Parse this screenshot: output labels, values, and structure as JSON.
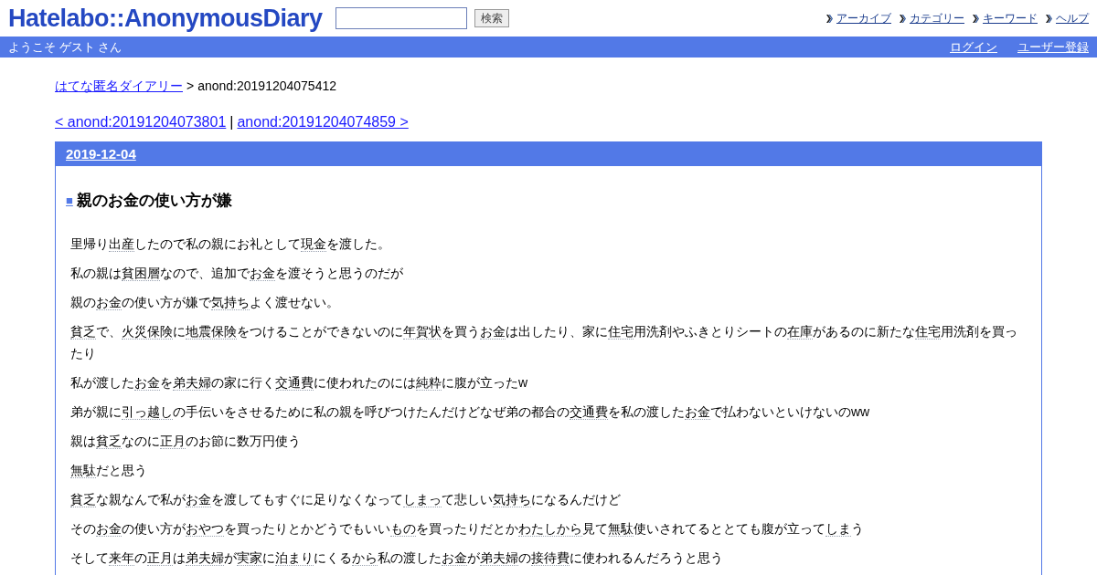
{
  "header": {
    "logo": "Hatelabo::AnonymousDiary",
    "search": {
      "button": "検索"
    },
    "links": [
      "アーカイブ",
      "カテゴリー",
      "キーワード",
      "ヘルプ"
    ]
  },
  "user_bar": {
    "welcome": "ようこそ ゲスト さん",
    "links": [
      "ログイン",
      "ユーザー登録"
    ]
  },
  "breadcrumb": {
    "home": "はてな匿名ダイアリー",
    "separator": ">",
    "current": "anond:20191204075412"
  },
  "pager": {
    "prev": "< anond:20191204073801",
    "separator": "|",
    "next": "anond:20191204074859 >"
  },
  "day": {
    "date": "2019-12-04",
    "title_mark": "■",
    "title": "親のお金の使い方が嫌",
    "paragraphs": [
      [
        {
          "text": "里帰り",
          "keyword": false
        },
        {
          "text": "出産",
          "keyword": true
        },
        {
          "text": "したので私の親にお礼として",
          "keyword": false
        },
        {
          "text": "現金",
          "keyword": true
        },
        {
          "text": "を渡した。",
          "keyword": false
        }
      ],
      [
        {
          "text": "私の親は",
          "keyword": false
        },
        {
          "text": "貧困層",
          "keyword": true
        },
        {
          "text": "なので、追加で",
          "keyword": false
        },
        {
          "text": "お金",
          "keyword": true
        },
        {
          "text": "を渡そうと思うのだが",
          "keyword": false
        }
      ],
      [
        {
          "text": "親の",
          "keyword": false
        },
        {
          "text": "お金",
          "keyword": true
        },
        {
          "text": "の使い方が嫌で",
          "keyword": false
        },
        {
          "text": "気持ち",
          "keyword": true
        },
        {
          "text": "よく渡せない。",
          "keyword": false
        }
      ],
      [
        {
          "text": "貧乏",
          "keyword": true
        },
        {
          "text": "で、",
          "keyword": false
        },
        {
          "text": "火災保険",
          "keyword": true
        },
        {
          "text": "に",
          "keyword": false
        },
        {
          "text": "地震保険",
          "keyword": true
        },
        {
          "text": "をつけることができないのに",
          "keyword": false
        },
        {
          "text": "年賀状",
          "keyword": true
        },
        {
          "text": "を買う",
          "keyword": false
        },
        {
          "text": "お金",
          "keyword": true
        },
        {
          "text": "は出したり、家に",
          "keyword": false
        },
        {
          "text": "住宅",
          "keyword": true
        },
        {
          "text": "用洗剤やふきとりシートの",
          "keyword": false
        },
        {
          "text": "在庫",
          "keyword": true
        },
        {
          "text": "があるのに新たな",
          "keyword": false
        },
        {
          "text": "住宅",
          "keyword": true
        },
        {
          "text": "用洗剤を買ったり",
          "keyword": false
        }
      ],
      [
        {
          "text": "私が渡した",
          "keyword": false
        },
        {
          "text": "お金",
          "keyword": true
        },
        {
          "text": "を",
          "keyword": false
        },
        {
          "text": "弟夫婦",
          "keyword": true
        },
        {
          "text": "の家に行く",
          "keyword": false
        },
        {
          "text": "交通費",
          "keyword": true
        },
        {
          "text": "に使われたのには",
          "keyword": false
        },
        {
          "text": "純粋",
          "keyword": true
        },
        {
          "text": "に腹が立ったw",
          "keyword": false
        }
      ],
      [
        {
          "text": "弟が親に",
          "keyword": false
        },
        {
          "text": "引っ越し",
          "keyword": true
        },
        {
          "text": "の手伝いをさせるために私の親を呼びつけたんだけどなぜ弟の都合の",
          "keyword": false
        },
        {
          "text": "交通費",
          "keyword": true
        },
        {
          "text": "を私の渡した",
          "keyword": false
        },
        {
          "text": "お金",
          "keyword": true
        },
        {
          "text": "で払わないといけないのww",
          "keyword": false
        }
      ],
      [
        {
          "text": "親は",
          "keyword": false
        },
        {
          "text": "貧乏",
          "keyword": true
        },
        {
          "text": "なのに",
          "keyword": false
        },
        {
          "text": "正月",
          "keyword": true
        },
        {
          "text": "のお節に数万円使う",
          "keyword": false
        }
      ],
      [
        {
          "text": "無駄",
          "keyword": true
        },
        {
          "text": "だと思う",
          "keyword": false
        }
      ],
      [
        {
          "text": "貧乏",
          "keyword": true
        },
        {
          "text": "な親なんで私が",
          "keyword": false
        },
        {
          "text": "お金",
          "keyword": true
        },
        {
          "text": "を渡してもすぐに足りなくなって",
          "keyword": false
        },
        {
          "text": "しまっ",
          "keyword": true
        },
        {
          "text": "て悲しい",
          "keyword": false
        },
        {
          "text": "気持ち",
          "keyword": true
        },
        {
          "text": "になるんだけど",
          "keyword": false
        }
      ],
      [
        {
          "text": "その",
          "keyword": false
        },
        {
          "text": "お金",
          "keyword": true
        },
        {
          "text": "の使い方が",
          "keyword": false
        },
        {
          "text": "おやつ",
          "keyword": true
        },
        {
          "text": "を買ったりとかどうでもいい",
          "keyword": false
        },
        {
          "text": "もの",
          "keyword": true
        },
        {
          "text": "を買ったりだとか",
          "keyword": false
        },
        {
          "text": "わたしから",
          "keyword": true
        },
        {
          "text": "見て",
          "keyword": false
        },
        {
          "text": "無駄",
          "keyword": true
        },
        {
          "text": "使いされてるととても腹が立って",
          "keyword": false
        },
        {
          "text": "しま",
          "keyword": true
        },
        {
          "text": "う",
          "keyword": false
        }
      ],
      [
        {
          "text": "そして",
          "keyword": false
        },
        {
          "text": "来年",
          "keyword": true
        },
        {
          "text": "の",
          "keyword": false
        },
        {
          "text": "正月",
          "keyword": true
        },
        {
          "text": "は",
          "keyword": false
        },
        {
          "text": "弟夫婦",
          "keyword": true
        },
        {
          "text": "が",
          "keyword": false
        },
        {
          "text": "実家",
          "keyword": true
        },
        {
          "text": "に",
          "keyword": false
        },
        {
          "text": "泊まり",
          "keyword": true
        },
        {
          "text": "にくる",
          "keyword": false
        },
        {
          "text": "から",
          "keyword": true
        },
        {
          "text": "私の渡した",
          "keyword": false
        },
        {
          "text": "お金",
          "keyword": true
        },
        {
          "text": "が",
          "keyword": false
        },
        {
          "text": "弟夫婦",
          "keyword": true
        },
        {
          "text": "の",
          "keyword": false
        },
        {
          "text": "接待費",
          "keyword": true
        },
        {
          "text": "に使われるんだろうと思う",
          "keyword": false
        }
      ]
    ]
  }
}
